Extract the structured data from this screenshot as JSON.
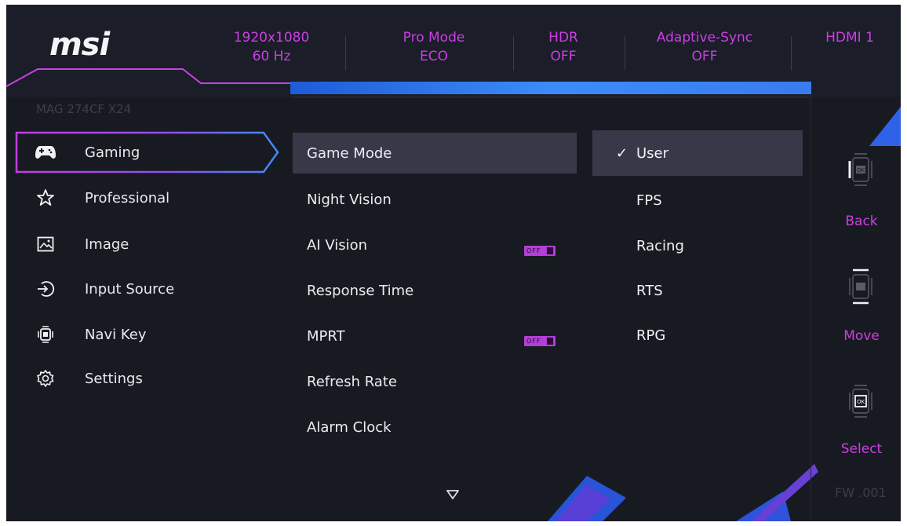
{
  "header": {
    "logo": "msi",
    "model": "MAG 274CF X24",
    "status": [
      {
        "line1": "1920x1080",
        "line2": "60 Hz"
      },
      {
        "line1": "Pro Mode",
        "line2": "ECO"
      },
      {
        "line1": "HDR",
        "line2": "OFF"
      },
      {
        "line1": "Adaptive-Sync",
        "line2": "OFF"
      },
      {
        "line1": "HDMI 1",
        "line2": ""
      }
    ]
  },
  "menu": {
    "items": [
      {
        "label": "Gaming",
        "icon": "gamepad-icon"
      },
      {
        "label": "Professional",
        "icon": "star-icon"
      },
      {
        "label": "Image",
        "icon": "image-icon"
      },
      {
        "label": "Input Source",
        "icon": "input-source-icon"
      },
      {
        "label": "Navi Key",
        "icon": "navi-key-icon"
      },
      {
        "label": "Settings",
        "icon": "gear-icon"
      }
    ],
    "selected_index": 0
  },
  "submenu": {
    "items": [
      {
        "label": "Game Mode"
      },
      {
        "label": "Night Vision"
      },
      {
        "label": "AI Vision",
        "badge": "OFF"
      },
      {
        "label": "Response Time"
      },
      {
        "label": "MPRT",
        "badge": "OFF"
      },
      {
        "label": "Refresh Rate"
      },
      {
        "label": "Alarm Clock"
      }
    ],
    "selected_index": 0,
    "more_icon": "triangle-down-icon"
  },
  "options": {
    "items": [
      {
        "label": "User",
        "checked": true
      },
      {
        "label": "FPS"
      },
      {
        "label": "Racing"
      },
      {
        "label": "RTS"
      },
      {
        "label": "RPG"
      }
    ],
    "check_glyph": "✓"
  },
  "navigator": {
    "back": "Back",
    "move": "Move",
    "select": "Select",
    "ok": "OK",
    "firmware": "FW .001"
  },
  "colors": {
    "accent": "#cc3fe3",
    "background": "#181a22",
    "highlight": "#373948",
    "blue": "#2f6fee"
  }
}
